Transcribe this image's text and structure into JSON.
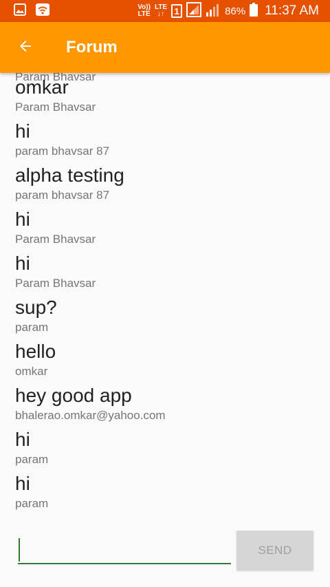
{
  "status_bar": {
    "volte": "Vo))",
    "lte_top": "LTE",
    "lte_label": "LTE",
    "sim_slot": "1",
    "battery_percent": "86%",
    "time": "11:37 AM"
  },
  "app_bar": {
    "title": "Forum"
  },
  "messages": {
    "first_author": "Param Bhavsar",
    "items": [
      {
        "text": "omkar",
        "author": "Param Bhavsar"
      },
      {
        "text": "hi",
        "author": "param bhavsar 87"
      },
      {
        "text": "alpha testing",
        "author": "param bhavsar 87"
      },
      {
        "text": "hi",
        "author": "Param Bhavsar"
      },
      {
        "text": "hi",
        "author": "Param Bhavsar"
      },
      {
        "text": "sup?",
        "author": "param"
      },
      {
        "text": "hello",
        "author": "omkar"
      },
      {
        "text": "hey good app",
        "author": "bhalerao.omkar@yahoo.com"
      },
      {
        "text": "hi",
        "author": "param"
      },
      {
        "text": "hi",
        "author": "param"
      }
    ]
  },
  "composer": {
    "input_value": "",
    "send_label": "SEND"
  },
  "colors": {
    "status_bar": "#e65100",
    "app_bar": "#ff9800",
    "input_underline": "#2e7d32",
    "send_button": "#d6d6d6"
  }
}
